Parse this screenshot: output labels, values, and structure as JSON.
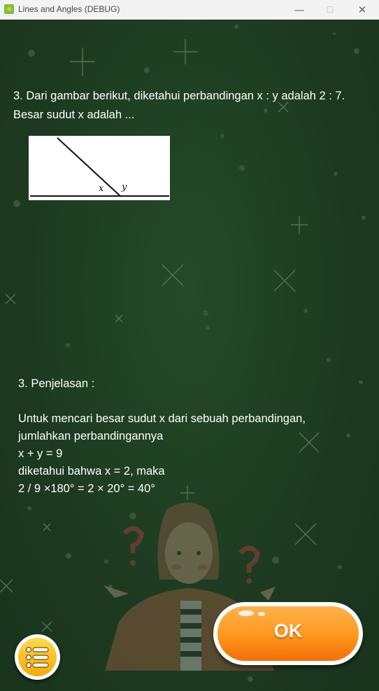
{
  "window": {
    "title": "Lines and Angles (DEBUG)",
    "minimize_glyph": "—",
    "maximize_glyph": "☐",
    "close_glyph": "✕"
  },
  "question": {
    "line1": "3. Dari gambar berikut, diketahui perbandingan x : y adalah 2 : 7.",
    "line2": "Besar sudut x adalah ..."
  },
  "figure": {
    "label_x": "x",
    "label_y": "y"
  },
  "explanation": {
    "heading": "3. Penjelasan :",
    "lines": [
      "Untuk mencari besar sudut x dari sebuah perbandingan,",
      "jumlahkan perbandingannya",
      "x + y = 9",
      "diketahui bahwa x = 2, maka",
      "2 / 9 ×180° = 2 × 20° = 40°"
    ]
  },
  "buttons": {
    "ok_label": "OK",
    "menu_icon": "list-icon"
  },
  "colors": {
    "background": "#1f3d22",
    "ok_orange": "#ff9a1f",
    "menu_yellow": "#f5b915"
  }
}
